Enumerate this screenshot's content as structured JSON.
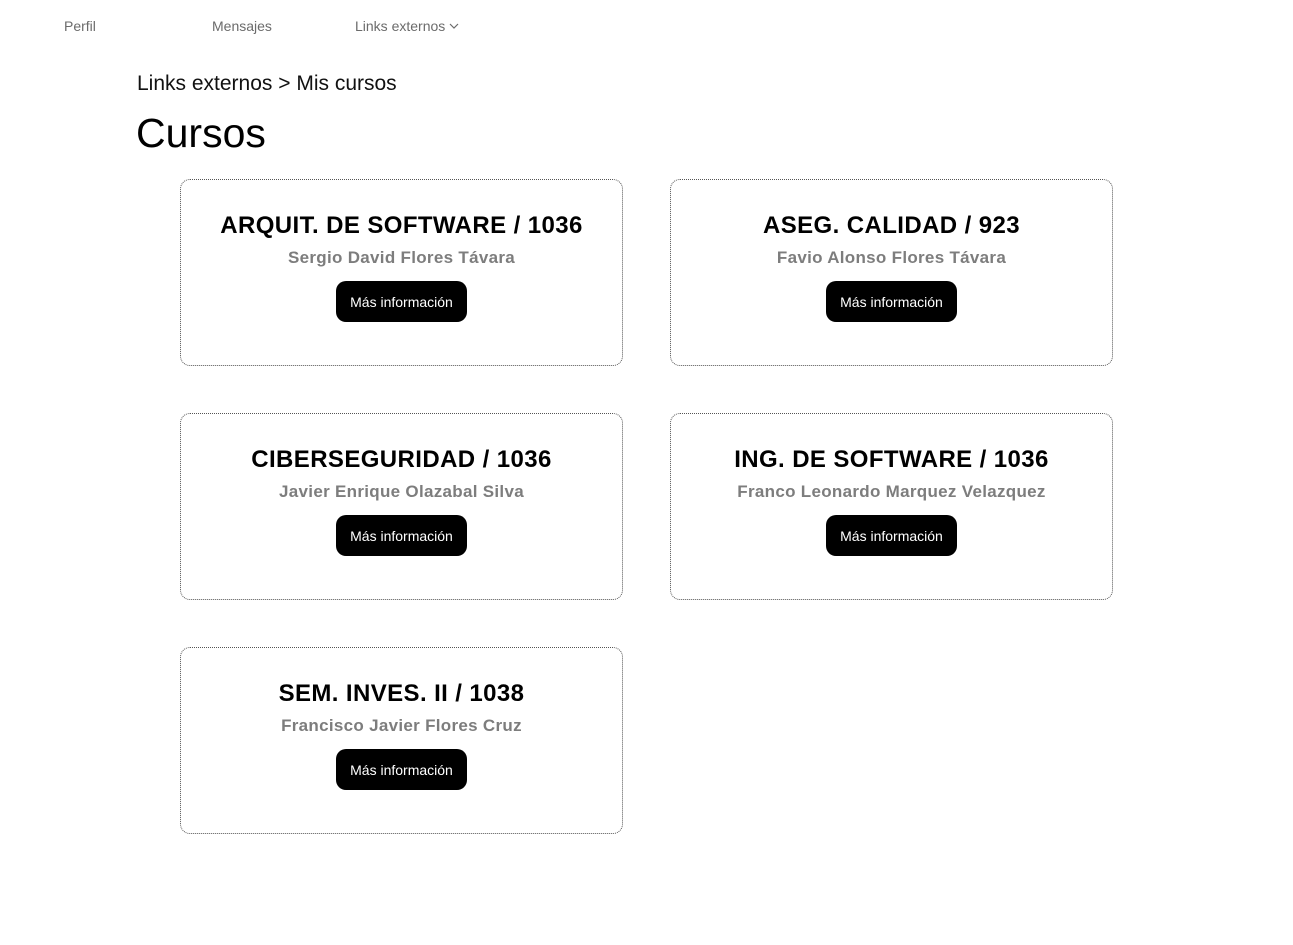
{
  "nav": {
    "perfil": "Perfil",
    "mensajes": "Mensajes",
    "links": "Links externos"
  },
  "breadcrumb": "Links externos > Mis cursos",
  "page_title": "Cursos",
  "courses": [
    {
      "title": "ARQUIT. DE SOFTWARE / 1036",
      "teacher": "Sergio David Flores Távara",
      "button": "Más información"
    },
    {
      "title": "ASEG. CALIDAD / 923",
      "teacher": "Favio Alonso Flores Távara",
      "button": "Más información"
    },
    {
      "title": "CIBERSEGURIDAD / 1036",
      "teacher": "Javier Enrique Olazabal Silva",
      "button": "Más información"
    },
    {
      "title": "ING. DE SOFTWARE / 1036",
      "teacher": "Franco Leonardo Marquez Velazquez",
      "button": "Más información"
    },
    {
      "title": "SEM. INVES. II / 1038",
      "teacher": "Francisco Javier Flores Cruz",
      "button": "Más información"
    }
  ]
}
